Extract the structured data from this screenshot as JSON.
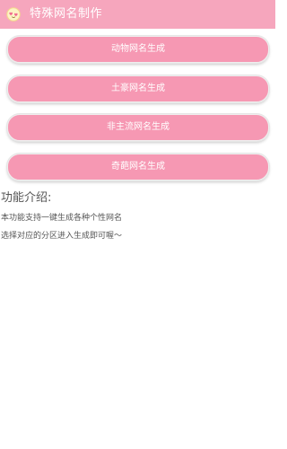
{
  "app_bar": {
    "title": "特殊网名制作",
    "icon": "heart-swap-icon",
    "background": "#f6a6bd"
  },
  "buttons": [
    {
      "label": "动物网名生成"
    },
    {
      "label": "土豪网名生成"
    },
    {
      "label": "非主流网名生成"
    },
    {
      "label": "奇葩网名生成"
    }
  ],
  "button_color": "#f698b3",
  "intro": {
    "title": "功能介绍:",
    "lines": [
      "本功能支持一键生成各种个性网名",
      "选择对应的分区进入生成即可喔～"
    ]
  }
}
